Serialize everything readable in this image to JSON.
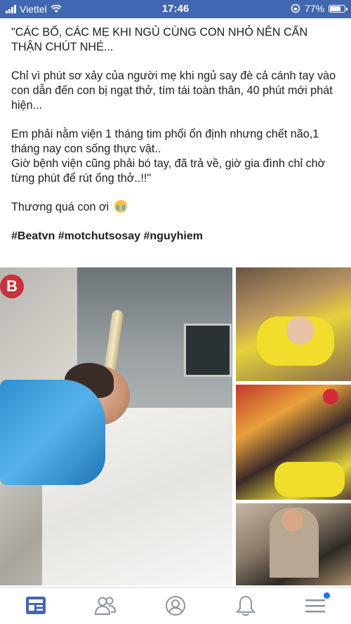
{
  "status_bar": {
    "carrier": "Viettel",
    "time": "17:46",
    "battery": "77%",
    "battery_level": 0.77
  },
  "post": {
    "paragraph1": "\"CÁC BỐ, CÁC MẸ KHI NGỦ CÙNG CON NHỎ NÊN CẨN THẬN CHÚT NHÉ...",
    "paragraph2": "Chỉ vì phút sơ xảy của người mẹ khi ngủ say đè cả cánh tay vào con dẫn đến con bị ngạt thở, tím tái toàn thân, 40 phút mới phát hiện...",
    "paragraph3a": "Em phải nằm viện 1 tháng tim phổi ổn định nhưng chết não,1 tháng nay con sống thực vật..",
    "paragraph3b": "Giờ bệnh viện cũng phải bó tay, đã trả về, giờ gia đình chỉ chờ từng phút để rút ống thở..!!\"",
    "paragraph4": "Thương quá con ơi",
    "hashtags": "#Beatvn #motchutsosay #nguyhiem"
  },
  "photos": {
    "main_logo_text": "B"
  },
  "bottom_nav": {
    "items": [
      "news-feed",
      "friends",
      "profile",
      "notifications",
      "menu"
    ]
  },
  "colors": {
    "brand": "#4267b2",
    "nav_active": "#4267b2",
    "nav_inactive": "#8d949e",
    "badge": "#1877f2"
  }
}
